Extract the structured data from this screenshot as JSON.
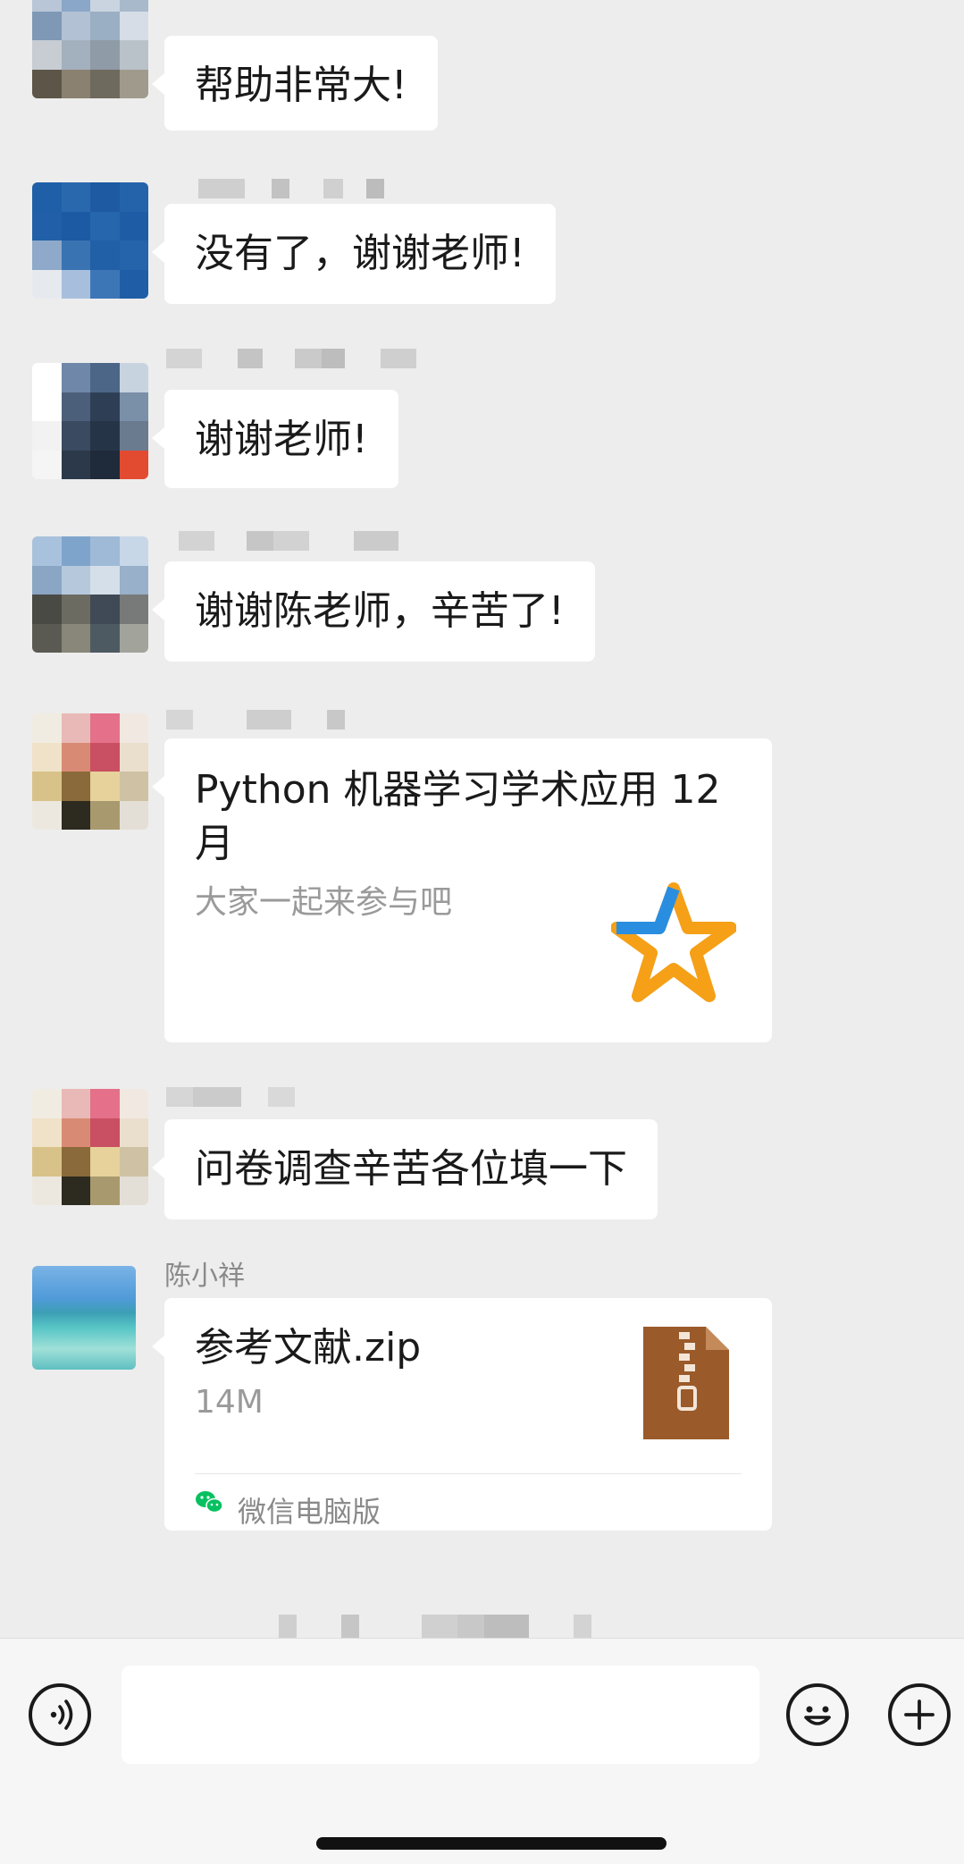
{
  "messages": [
    {
      "type": "text",
      "text": "帮助非常大!"
    },
    {
      "type": "text",
      "text": "没有了，谢谢老师!"
    },
    {
      "type": "text",
      "text": "谢谢老师!"
    },
    {
      "type": "text",
      "text": "谢谢陈老师，辛苦了!"
    },
    {
      "type": "link",
      "title": "Python 机器学习学术应用 12月",
      "desc": "大家一起来参与吧",
      "icon": "star-logo-icon"
    },
    {
      "type": "text",
      "text": "问卷调查辛苦各位填一下"
    },
    {
      "type": "file",
      "sender": "陈小祥",
      "file_name": "参考文献.zip",
      "file_size": "14M",
      "source": "微信电脑版",
      "icon": "zip-file-icon"
    }
  ],
  "toolbar": {
    "voice_icon": "voice-icon",
    "emoji_icon": "emoji-icon",
    "more_icon": "plus-icon",
    "input_value": ""
  },
  "colors": {
    "background": "#ededed",
    "bubble": "#ffffff",
    "wechat_green": "#07c160",
    "zip_brown": "#9a5a2a"
  }
}
